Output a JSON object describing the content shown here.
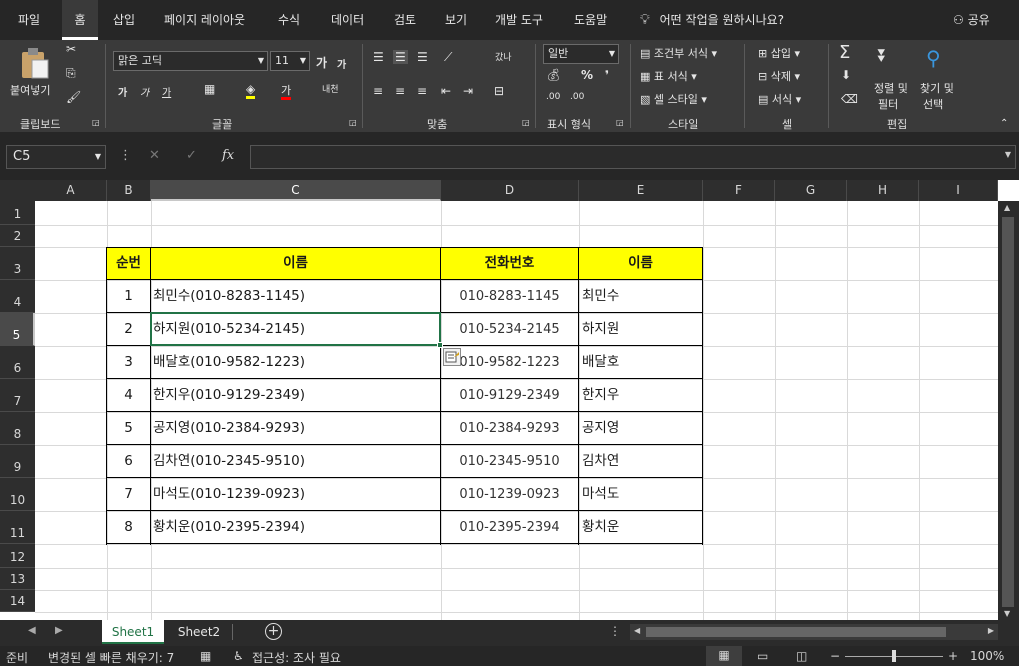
{
  "menu": {
    "tabs": [
      "파일",
      "홈",
      "삽입",
      "페이지 레이아웃",
      "수식",
      "데이터",
      "검토",
      "보기",
      "개발 도구",
      "도움말"
    ],
    "tell_me": "어떤 작업을 원하시나요?",
    "share": "공유"
  },
  "ribbon": {
    "clipboard": {
      "paste": "붙여넣기",
      "label": "클립보드"
    },
    "font": {
      "name": "맑은 고딕",
      "size": "11",
      "label": "글꼴",
      "grow": "가",
      "shrink": "가",
      "bold": "가",
      "italic": "가",
      "underline": "가",
      "color_letter": "가",
      "phonetic": "내천"
    },
    "alignment": {
      "label": "맞춤",
      "wrap": "갔나"
    },
    "number": {
      "format": "일반",
      "label": "표시 형식",
      "percent": "%",
      "comma": "❜",
      "inc_decimal": ".00",
      "dec_decimal": ".00"
    },
    "styles": {
      "conditional": "조건부 서식",
      "table": "표 서식",
      "cell": "셀 스타일",
      "label": "스타일"
    },
    "cells": {
      "insert": "삽입",
      "delete": "삭제",
      "format": "서식",
      "label": "셀"
    },
    "editing": {
      "sort": "정렬 및",
      "filter": "필터",
      "find": "찾기 및",
      "select": "선택",
      "sigma": "Σ",
      "label": "편집"
    }
  },
  "formula_bar": {
    "name_box": "C5",
    "cancel": "✕",
    "enter": "✓",
    "fx": "fx",
    "value": ""
  },
  "columns": [
    "A",
    "B",
    "C",
    "D",
    "E",
    "F",
    "G",
    "H",
    "I"
  ],
  "rows": [
    "1",
    "2",
    "3",
    "4",
    "5",
    "6",
    "7",
    "8",
    "9",
    "10",
    "11",
    "12",
    "13",
    "14"
  ],
  "table": {
    "headers": [
      "순번",
      "이름",
      "전화번호",
      "이름"
    ],
    "rows": [
      [
        "1",
        "최민수(010-8283-1145)",
        "010-8283-1145",
        "최민수"
      ],
      [
        "2",
        "하지원(010-5234-2145)",
        "010-5234-2145",
        "하지원"
      ],
      [
        "3",
        "배달호(010-9582-1223)",
        "010-9582-1223",
        "배달호"
      ],
      [
        "4",
        "한지우(010-9129-2349)",
        "010-9129-2349",
        "한지우"
      ],
      [
        "5",
        "공지영(010-2384-9293)",
        "010-2384-9293",
        "공지영"
      ],
      [
        "6",
        "김차연(010-2345-9510)",
        "010-2345-9510",
        "김차연"
      ],
      [
        "7",
        "마석도(010-1239-0923)",
        "010-1239-0923",
        "마석도"
      ],
      [
        "8",
        "황치운(010-2395-2394)",
        "010-2395-2394",
        "황치운"
      ]
    ]
  },
  "sheets": [
    "Sheet1",
    "Sheet2"
  ],
  "status": {
    "ready": "준비",
    "flash_fill": "변경된 셀 빠른 채우기: 7",
    "accessibility": "접근성: 조사 필요",
    "zoom": "100%",
    "minus": "−",
    "plus": "+"
  },
  "colors": {
    "header_fill": "#ffff00",
    "active_tab": "#217346",
    "selection_border": "#217346"
  }
}
